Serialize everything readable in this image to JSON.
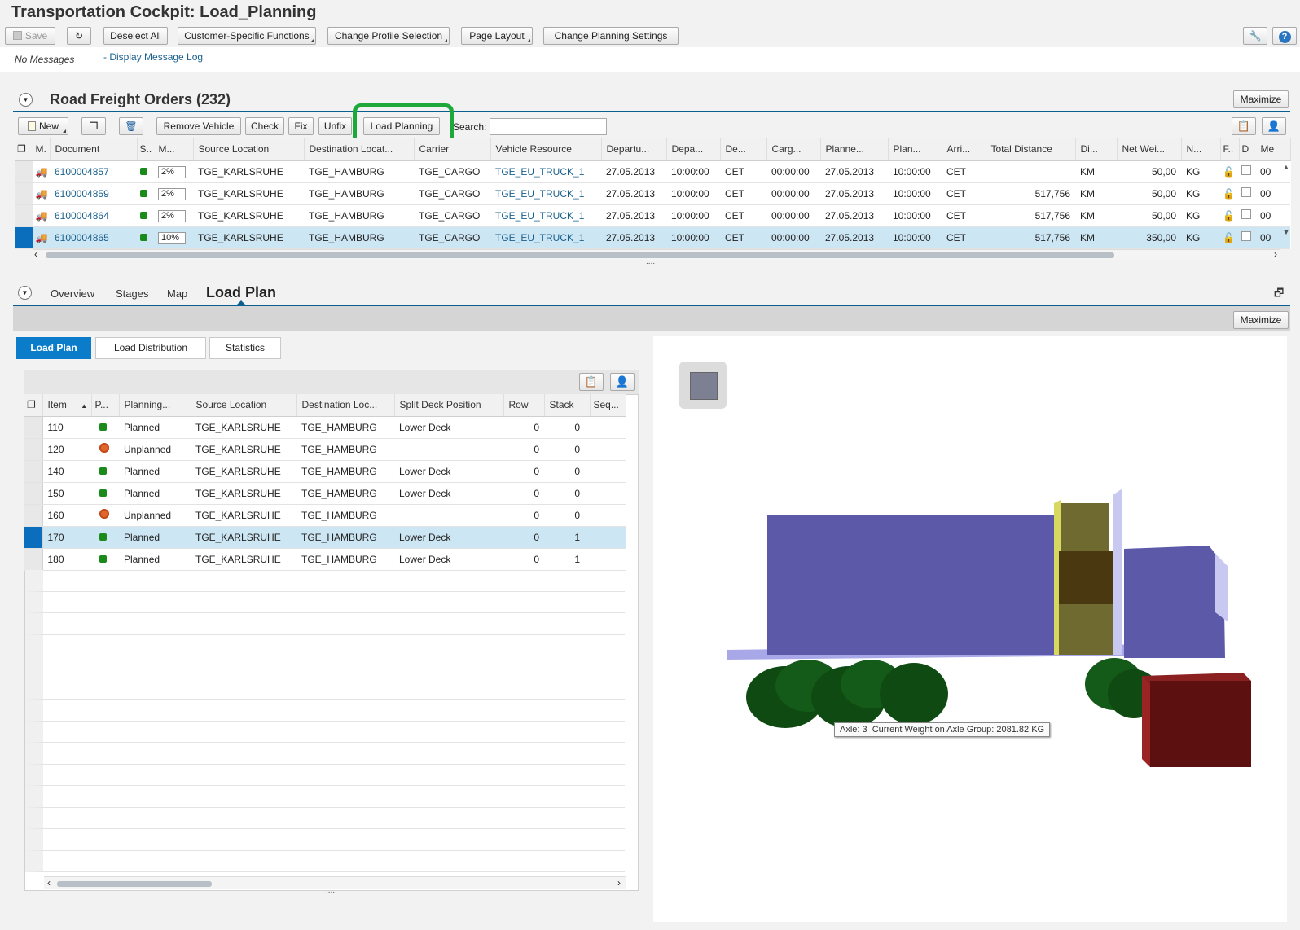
{
  "app": {
    "title": "Transportation Cockpit: Load_Planning"
  },
  "toolbar": {
    "save": "Save",
    "deselect_all": "Deselect All",
    "customer_functions": "Customer-Specific Functions",
    "change_profile": "Change Profile Selection",
    "page_layout": "Page Layout",
    "change_planning": "Change Planning Settings"
  },
  "messages": {
    "status": "No Messages",
    "log_link": "Display Message Log"
  },
  "freight": {
    "title": "Road Freight Orders (232)",
    "maximize": "Maximize",
    "buttons": {
      "new": "New",
      "remove_vehicle": "Remove Vehicle",
      "check": "Check",
      "fix": "Fix",
      "unfix": "Unfix",
      "load_planning": "Load Planning",
      "search_label": "Search:"
    },
    "columns": [
      "M.",
      "Document",
      "S..",
      "M...",
      "Source Location",
      "Destination Locat...",
      "Carrier",
      "Vehicle Resource",
      "Departu...",
      "Depa...",
      "De...",
      "Carg...",
      "Planne...",
      "Plan...",
      "Arri...",
      "Total Distance",
      "Di...",
      "Net Wei...",
      "N...",
      "F..",
      "D",
      "Me"
    ],
    "rows": [
      {
        "doc": "6100004857",
        "pct": "2%",
        "src": "TGE_KARLSRUHE",
        "dst": "TGE_HAMBURG",
        "carrier": "TGE_CARGO",
        "vehicle": "TGE_EU_TRUCK_1",
        "dep_date": "27.05.2013",
        "dep_time": "10:00:00",
        "tz": "CET",
        "cargo": "00:00:00",
        "plan_date": "27.05.2013",
        "plan_time": "10:00:00",
        "arr_tz": "CET",
        "dist": "",
        "unit": "KM",
        "weight": "50,00",
        "wunit": "KG",
        "me": "00"
      },
      {
        "doc": "6100004859",
        "pct": "2%",
        "src": "TGE_KARLSRUHE",
        "dst": "TGE_HAMBURG",
        "carrier": "TGE_CARGO",
        "vehicle": "TGE_EU_TRUCK_1",
        "dep_date": "27.05.2013",
        "dep_time": "10:00:00",
        "tz": "CET",
        "cargo": "00:00:00",
        "plan_date": "27.05.2013",
        "plan_time": "10:00:00",
        "arr_tz": "CET",
        "dist": "517,756",
        "unit": "KM",
        "weight": "50,00",
        "wunit": "KG",
        "me": "00"
      },
      {
        "doc": "6100004864",
        "pct": "2%",
        "src": "TGE_KARLSRUHE",
        "dst": "TGE_HAMBURG",
        "carrier": "TGE_CARGO",
        "vehicle": "TGE_EU_TRUCK_1",
        "dep_date": "27.05.2013",
        "dep_time": "10:00:00",
        "tz": "CET",
        "cargo": "00:00:00",
        "plan_date": "27.05.2013",
        "plan_time": "10:00:00",
        "arr_tz": "CET",
        "dist": "517,756",
        "unit": "KM",
        "weight": "50,00",
        "wunit": "KG",
        "me": "00"
      },
      {
        "doc": "6100004865",
        "pct": "10%",
        "src": "TGE_KARLSRUHE",
        "dst": "TGE_HAMBURG",
        "carrier": "TGE_CARGO",
        "vehicle": "TGE_EU_TRUCK_1",
        "dep_date": "27.05.2013",
        "dep_time": "10:00:00",
        "tz": "CET",
        "cargo": "00:00:00",
        "plan_date": "27.05.2013",
        "plan_time": "10:00:00",
        "arr_tz": "CET",
        "dist": "517,756",
        "unit": "KM",
        "weight": "350,00",
        "wunit": "KG",
        "me": "00"
      }
    ]
  },
  "detail": {
    "tabs": [
      "Overview",
      "Stages",
      "Map",
      "Load Plan"
    ],
    "maximize": "Maximize",
    "subtabs": [
      "Load Plan",
      "Load Distribution",
      "Statistics"
    ],
    "columns": [
      "Item",
      "P...",
      "Planning...",
      "Source Location",
      "Destination Loc...",
      "Split Deck Position",
      "Row",
      "Stack",
      "Seq..."
    ],
    "items": [
      {
        "item": "110",
        "status": "green",
        "planning": "Planned",
        "src": "TGE_KARLSRUHE",
        "dst": "TGE_HAMBURG",
        "deck": "Lower Deck",
        "row": "0",
        "stack": "0"
      },
      {
        "item": "120",
        "status": "orange",
        "planning": "Unplanned",
        "src": "TGE_KARLSRUHE",
        "dst": "TGE_HAMBURG",
        "deck": "",
        "row": "0",
        "stack": "0"
      },
      {
        "item": "140",
        "status": "green",
        "planning": "Planned",
        "src": "TGE_KARLSRUHE",
        "dst": "TGE_HAMBURG",
        "deck": "Lower Deck",
        "row": "0",
        "stack": "0"
      },
      {
        "item": "150",
        "status": "green",
        "planning": "Planned",
        "src": "TGE_KARLSRUHE",
        "dst": "TGE_HAMBURG",
        "deck": "Lower Deck",
        "row": "0",
        "stack": "0"
      },
      {
        "item": "160",
        "status": "orange",
        "planning": "Unplanned",
        "src": "TGE_KARLSRUHE",
        "dst": "TGE_HAMBURG",
        "deck": "",
        "row": "0",
        "stack": "0"
      },
      {
        "item": "170",
        "status": "green",
        "planning": "Planned",
        "src": "TGE_KARLSRUHE",
        "dst": "TGE_HAMBURG",
        "deck": "Lower Deck",
        "row": "0",
        "stack": "1"
      },
      {
        "item": "180",
        "status": "green",
        "planning": "Planned",
        "src": "TGE_KARLSRUHE",
        "dst": "TGE_HAMBURG",
        "deck": "Lower Deck",
        "row": "0",
        "stack": "1"
      }
    ],
    "tooltip": "Axle: 3  Current Weight on Axle Group: 2081.82 KG"
  },
  "colors": {
    "accent": "#0a7cc9",
    "highlight": "#1fa83a",
    "trailer": "#5c5aa8",
    "wheels": "#0f4a12",
    "cargo_box": "#5c1010"
  }
}
